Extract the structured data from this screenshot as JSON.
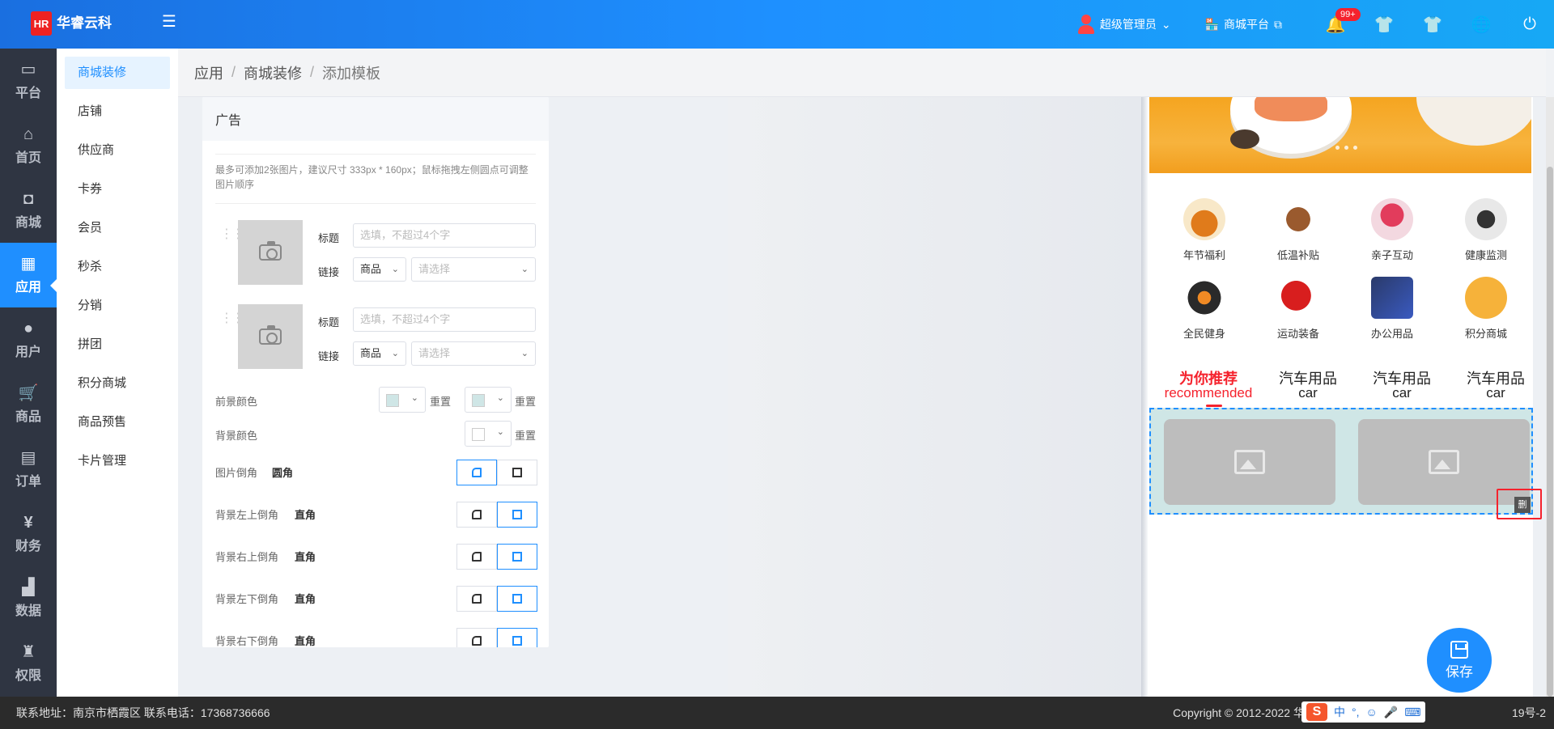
{
  "topbar": {
    "logo_mark": "HR",
    "logo_text": "华睿云科",
    "user": "超级管理员",
    "mall": "商城平台",
    "badge": "99+"
  },
  "leftnav": [
    {
      "label": "平台",
      "icon": "monitor-icon"
    },
    {
      "label": "首页",
      "icon": "home-icon"
    },
    {
      "label": "商城",
      "icon": "bag-icon"
    },
    {
      "label": "应用",
      "icon": "apps-icon",
      "active": true
    },
    {
      "label": "用户",
      "icon": "user-icon"
    },
    {
      "label": "商品",
      "icon": "cart-icon"
    },
    {
      "label": "订单",
      "icon": "document-icon"
    },
    {
      "label": "财务",
      "icon": "finance-icon"
    },
    {
      "label": "数据",
      "icon": "chart-icon"
    },
    {
      "label": "权限",
      "icon": "permission-icon"
    }
  ],
  "submenu": [
    {
      "label": "商城装修",
      "active": true
    },
    {
      "label": "店铺"
    },
    {
      "label": "供应商"
    },
    {
      "label": "卡券"
    },
    {
      "label": "会员"
    },
    {
      "label": "秒杀"
    },
    {
      "label": "分销"
    },
    {
      "label": "拼团"
    },
    {
      "label": "积分商城"
    },
    {
      "label": "商品预售"
    },
    {
      "label": "卡片管理"
    }
  ],
  "breadcrumb": [
    "应用",
    "商城装修",
    "添加模板"
  ],
  "panel": {
    "title": "广告",
    "tip": "最多可添加2张图片，建议尺寸 333px * 160px；鼠标拖拽左侧圆点可调整图片顺序",
    "items": [
      {
        "title_label": "标题",
        "title_placeholder": "选填，不超过4个字",
        "link_label": "链接",
        "link_type": "商品",
        "link_placeholder": "请选择"
      },
      {
        "title_label": "标题",
        "title_placeholder": "选填，不超过4个字",
        "link_label": "链接",
        "link_type": "商品",
        "link_placeholder": "请选择"
      }
    ],
    "fg_color_label": "前景颜色",
    "bg_color_label": "背景颜色",
    "reset": "重置",
    "fg_color": "#cfe6e6",
    "bg_color": "#ffffff",
    "props": [
      {
        "label": "图片倒角",
        "value": "圆角",
        "selected": "round"
      },
      {
        "label": "背景左上倒角",
        "value": "直角",
        "selected": "square"
      },
      {
        "label": "背景右上倒角",
        "value": "直角",
        "selected": "square"
      },
      {
        "label": "背景左下倒角",
        "value": "直角",
        "selected": "square"
      },
      {
        "label": "背景右下倒角",
        "value": "直角",
        "selected": "square"
      }
    ]
  },
  "preview": {
    "categories": [
      "年节福利",
      "低温补贴",
      "亲子互动",
      "健康监测",
      "全民健身",
      "运动装备",
      "办公用品",
      "积分商城"
    ],
    "tabs": [
      {
        "title": "为你推荐",
        "sub": "recommended",
        "active": true
      },
      {
        "title": "汽车用品",
        "sub": "car"
      },
      {
        "title": "汽车用品",
        "sub": "car"
      },
      {
        "title": "汽车用品",
        "sub": "car"
      }
    ],
    "delete_label": "删",
    "save": "保存"
  },
  "footer": {
    "left": "联系地址：南京市栖霞区 联系电话：17368736666",
    "right": "Copyright © 2012-2022 华睿",
    "tail": "19号-2",
    "ime": [
      "中",
      "°,",
      "☺",
      "🎤",
      "⌨"
    ]
  }
}
